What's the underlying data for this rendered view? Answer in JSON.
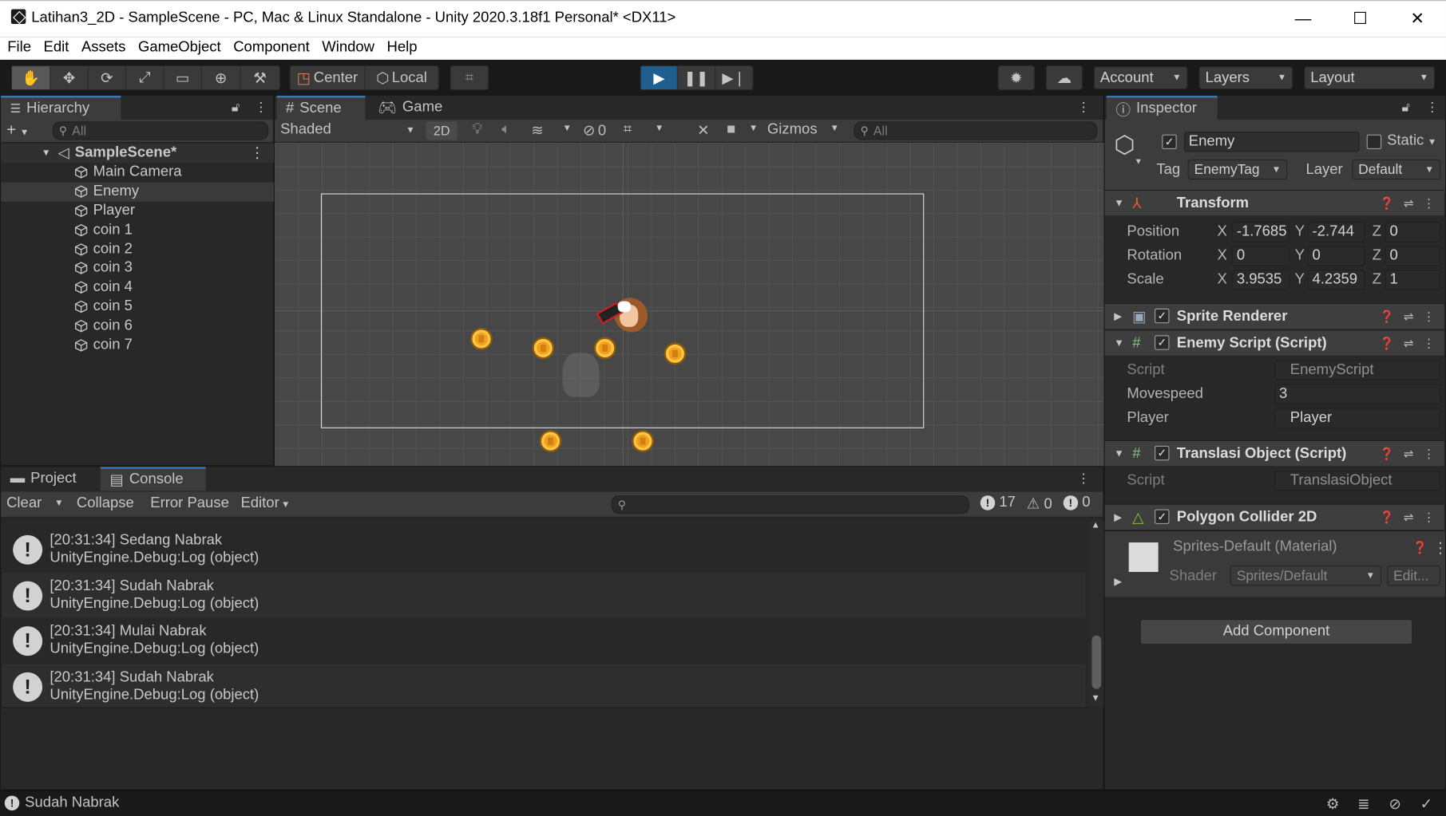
{
  "window": {
    "title": "Latihan3_2D - SampleScene - PC, Mac & Linux Standalone - Unity 2020.3.18f1 Personal* <DX11>",
    "minimize": "—",
    "maximize": "☐",
    "close": "✕"
  },
  "menu": [
    "File",
    "Edit",
    "Assets",
    "GameObject",
    "Component",
    "Window",
    "Help"
  ],
  "toolbar": {
    "tools": [
      "hand-icon",
      "move-icon",
      "rotate-icon",
      "scale-icon",
      "rect-icon",
      "transform-icon",
      "custom-tool-icon"
    ],
    "pivot": "Center",
    "space": "Local",
    "account": "Account",
    "layers": "Layers",
    "layout": "Layout"
  },
  "hierarchy": {
    "tab": "Hierarchy",
    "search_placeholder": "All",
    "add": "+",
    "scene": "SampleScene*",
    "items": [
      "Main Camera",
      "Enemy",
      "Player",
      "coin 1",
      "coin 2",
      "coin 3",
      "coin 4",
      "coin 5",
      "coin 6",
      "coin 7"
    ],
    "selected": "Enemy"
  },
  "scene": {
    "tabs": [
      "Scene",
      "Game"
    ],
    "shading": "Shaded",
    "mode2d": "2D",
    "hidden_count": "0",
    "gizmos": "Gizmos",
    "search_placeholder": "All"
  },
  "console": {
    "tabs": [
      "Project",
      "Console"
    ],
    "buttons": {
      "clear": "Clear",
      "collapse": "Collapse",
      "error_pause": "Error Pause",
      "editor": "Editor"
    },
    "counts": {
      "logs": "17",
      "warnings": "0",
      "errors": "0"
    },
    "entries": [
      {
        "msg": "[20:31:34] Sedang Nabrak",
        "detail": "UnityEngine.Debug:Log (object)"
      },
      {
        "msg": "[20:31:34] Sudah Nabrak",
        "detail": "UnityEngine.Debug:Log (object)"
      },
      {
        "msg": "[20:31:34] Mulai Nabrak",
        "detail": "UnityEngine.Debug:Log (object)"
      },
      {
        "msg": "[20:31:34] Sudah Nabrak",
        "detail": "UnityEngine.Debug:Log (object)"
      }
    ]
  },
  "inspector": {
    "tab": "Inspector",
    "object_name": "Enemy",
    "static_label": "Static",
    "tag_label": "Tag",
    "tag": "EnemyTag",
    "layer_label": "Layer",
    "layer": "Default",
    "transform": {
      "title": "Transform",
      "position_label": "Position",
      "rotation_label": "Rotation",
      "scale_label": "Scale",
      "position": {
        "x": "-1.7685",
        "y": "-2.744",
        "z": "0"
      },
      "rotation": {
        "x": "0",
        "y": "0",
        "z": "0"
      },
      "scale": {
        "x": "3.9535",
        "y": "4.2359",
        "z": "1"
      }
    },
    "sprite_renderer": "Sprite Renderer",
    "enemy_script": {
      "title": "Enemy Script (Script)",
      "script_label": "Script",
      "script": "EnemyScript",
      "movespeed_label": "Movespeed",
      "movespeed": "3",
      "player_label": "Player",
      "player": "Player"
    },
    "translasi": {
      "title": "Translasi Object (Script)",
      "script_label": "Script",
      "script": "TranslasiObject"
    },
    "collider": "Polygon Collider 2D",
    "material": {
      "title": "Sprites-Default (Material)",
      "shader_label": "Shader",
      "shader": "Sprites/Default",
      "edit": "Edit..."
    },
    "add_component": "Add Component"
  },
  "status": {
    "message": "Sudah Nabrak"
  },
  "colors": {
    "accent": "#3a79bb",
    "play_active": "#1f5f8f",
    "panel_bg": "#282828"
  }
}
